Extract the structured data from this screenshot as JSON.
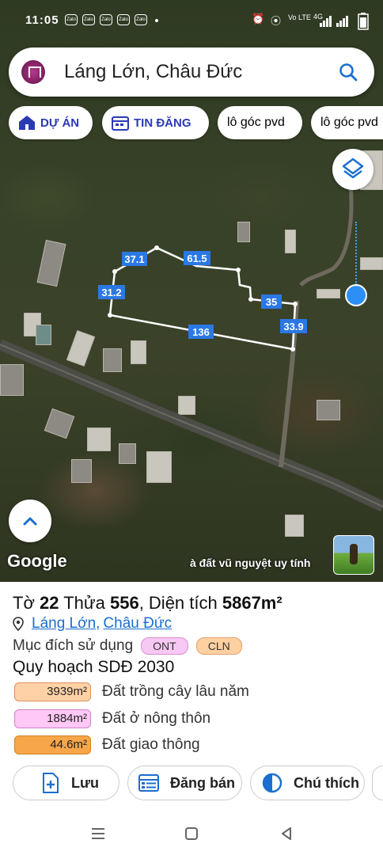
{
  "status_bar": {
    "time": "11:05",
    "notifications": [
      "Zalo",
      "Zalo",
      "Zalo",
      "Zalo",
      "Zalo"
    ],
    "network": "Vo LTE",
    "signal": "4G"
  },
  "search": {
    "title": "Láng Lớn, Châu Đức",
    "icon": "search-icon",
    "logo": "app-logo"
  },
  "chips": [
    {
      "label": "DỰ ÁN",
      "icon": "house-icon"
    },
    {
      "label": "TIN ĐĂNG",
      "icon": "calendar-icon"
    },
    {
      "label": "lô góc pvd"
    },
    {
      "label": "lô góc pvd"
    }
  ],
  "map": {
    "edge_labels": [
      "37.1",
      "61.5",
      "31.2",
      "35",
      "136",
      "33.9"
    ],
    "caption": "à đất vũ nguyệt uy tính",
    "provider": "Google",
    "accent": "#2b8ff5",
    "boundary_color": "#ffffff"
  },
  "info": {
    "title_prefix": "Tờ",
    "to_number": "22",
    "thua_label": "Thửa",
    "thua_number": "556",
    "area_label": ", Diện tích",
    "area_value": "5867m²",
    "location_1": "Láng Lớn",
    "location_sep": ",",
    "location_2": "Châu Đức",
    "purpose_label": "Mục đích sử dụng",
    "purpose_tags": [
      {
        "label": "ONT",
        "bg": "#f8c8f4",
        "border": "#d890d0"
      },
      {
        "label": "CLN",
        "bg": "#ffd0a0",
        "border": "#e0a070"
      }
    ],
    "plan_title": "Quy hoạch SDĐ 2030",
    "plan_rows": [
      {
        "area": "3939m²",
        "label": "Đất trồng cây lâu năm",
        "bg": "#ffd1a6",
        "border": "#e09060"
      },
      {
        "area": "1884m²",
        "label": "Đất ở nông thôn",
        "bg": "#ffc8f5",
        "border": "#d080c8"
      },
      {
        "area": "44.6m²",
        "label": "Đất giao thông",
        "bg": "#f7a64a",
        "border": "#d08020"
      }
    ]
  },
  "actions": [
    {
      "label": "Lưu",
      "icon": "save-add-icon"
    },
    {
      "label": "Đăng bán",
      "icon": "list-icon"
    },
    {
      "label": "Chú thích",
      "icon": "contrast-icon"
    }
  ],
  "navbar": {
    "icons": [
      "menu-icon",
      "home-icon",
      "back-icon"
    ]
  }
}
